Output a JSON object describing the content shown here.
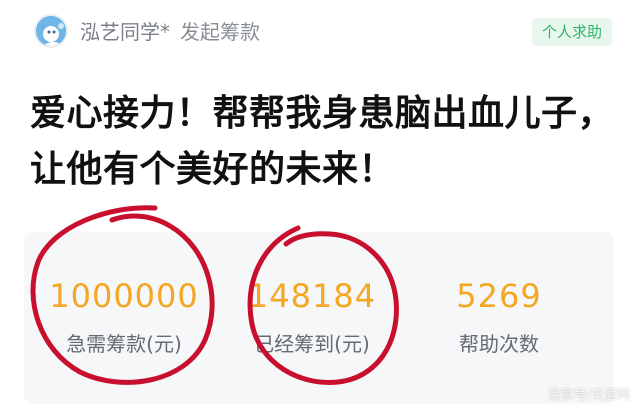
{
  "header": {
    "user_name": "泓艺同学*",
    "action_text": "发起筹款",
    "tag": "个人求助",
    "avatar_icon": "avatar-icon"
  },
  "title": "爱心接力！帮帮我身患脑出血儿子，让他有个美好的未来！",
  "stats": [
    {
      "value": "1000000",
      "label": "急需筹款(元)"
    },
    {
      "value": "148184",
      "label": "已经筹到(元)"
    },
    {
      "value": "5269",
      "label": "帮助次数"
    }
  ],
  "colors": {
    "accent": "#f5a623",
    "tag_green": "#2fb56a",
    "annotation_red": "#c8102e"
  },
  "watermark": "百家号/天涯网"
}
